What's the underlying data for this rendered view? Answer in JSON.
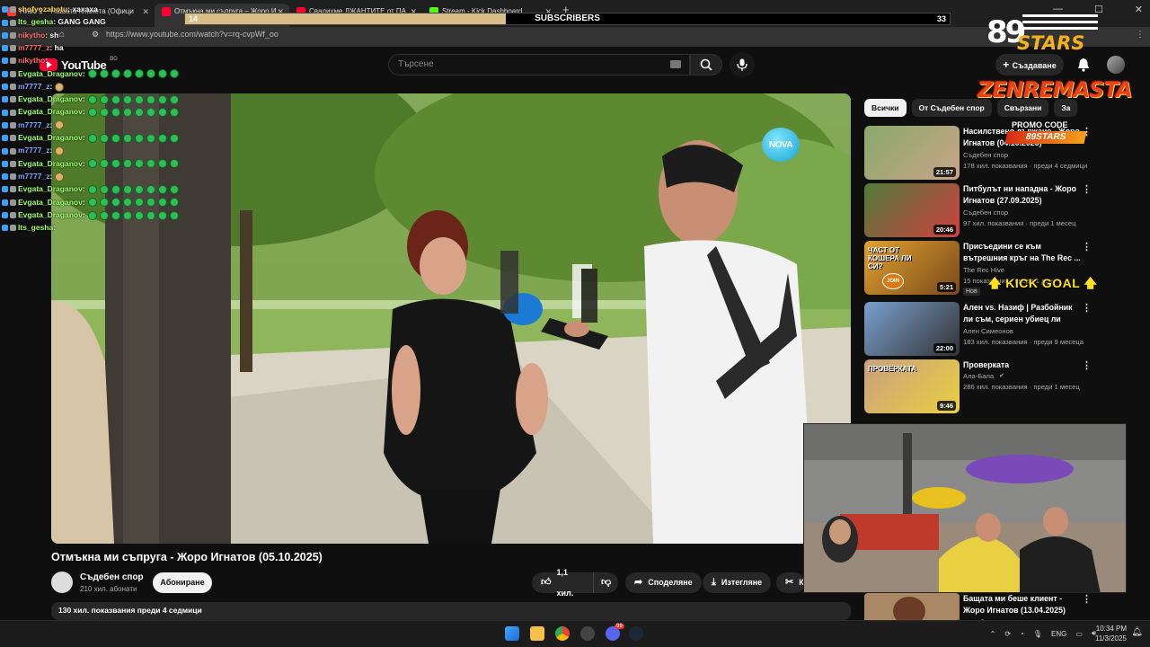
{
  "browser": {
    "tabs": [
      {
        "label": "Ниво 1 – Нашата планета (Офици",
        "fav_color": "#ff3b30"
      },
      {
        "label": "Отмъкна ми съпруга – Жоро И",
        "fav_color": "#ff0033"
      },
      {
        "label": "Свалихме ДЖАНТИТЕ от ПА",
        "fav_color": "#ff0033"
      },
      {
        "label": "Stream - Kick Dashboard",
        "fav_color": "#53fc18"
      }
    ],
    "url": "https://www.youtube.com/watch?v=rq-cvpWf_oo"
  },
  "subs_goal": {
    "current": "14",
    "label": "SUBSCRIBERS",
    "target": "33",
    "progress": 0.42
  },
  "chat": [
    {
      "user": "shofyozabotu",
      "msg": ": хахаха",
      "cls": "u4",
      "emotes": 0
    },
    {
      "user": "Its_gesha",
      "msg": ": GANG GANG",
      "cls": "u2",
      "emotes": 0
    },
    {
      "user": "nikytho",
      "msg": ": sh",
      "cls": "u3",
      "emotes": 0
    },
    {
      "user": "m7777_z",
      "msg": ": ha",
      "cls": "u3",
      "emotes": 0
    },
    {
      "user": "nikytho",
      "msg": ":",
      "cls": "u3",
      "emotes": 0
    },
    {
      "user": "Evgata_Draganov",
      "msg": ":",
      "cls": "u2",
      "emotes": 8
    },
    {
      "user": "m7777_z",
      "msg": ":",
      "cls": "u5",
      "emotes": 1
    },
    {
      "user": "Evgata_Draganov",
      "msg": ":",
      "cls": "u2",
      "emotes": 8
    },
    {
      "user": "Evgata_Draganov",
      "msg": ":",
      "cls": "u2",
      "emotes": 8
    },
    {
      "user": "m7777_z",
      "msg": ":",
      "cls": "u5",
      "emotes": 1
    },
    {
      "user": "Evgata_Draganov",
      "msg": ":",
      "cls": "u2",
      "emotes": 8
    },
    {
      "user": "m7777_z",
      "msg": ":",
      "cls": "u5",
      "emotes": 1
    },
    {
      "user": "Evgata_Draganov",
      "msg": ":",
      "cls": "u2",
      "emotes": 8
    },
    {
      "user": "m7777_z",
      "msg": ":",
      "cls": "u5",
      "emotes": 1
    },
    {
      "user": "Evgata_Draganov",
      "msg": ":",
      "cls": "u2",
      "emotes": 8
    },
    {
      "user": "Evgata_Draganov",
      "msg": ":",
      "cls": "u2",
      "emotes": 8
    },
    {
      "user": "Evgata_Draganov",
      "msg": ":",
      "cls": "u2",
      "emotes": 8
    },
    {
      "user": "Its_gesha",
      "msg": ":",
      "cls": "u2",
      "emotes": 0
    }
  ],
  "youtube": {
    "logo": "YouTube",
    "region": "BG",
    "search_placeholder": "Търсене",
    "create_label": "Създаване"
  },
  "video": {
    "title": "Отмъкна ми съпруга - Жоро Игнатов (05.10.2025)",
    "channel": "Съдебен спор",
    "channel_subs": "210 хил. абонати",
    "subscribe": "Абониране",
    "likes": "1,1 хил.",
    "share": "Споделяне",
    "download": "Изтегляне",
    "clip": "К",
    "views_line": "130 хил. показвания  преди 4 седмици",
    "logo_text": "NOVA"
  },
  "chips": [
    "Всички",
    "От Съдебен спор",
    "Свързани",
    "За"
  ],
  "recommendations": [
    {
      "title": "Насилствено държане - Жоро Игнатов (04.10.2025)",
      "channel": "Съдебен спор",
      "meta": "178 хил. показвания · преди 4 седмици",
      "dur": "21:57",
      "c1": "#8aa86a",
      "c2": "#c9a48a"
    },
    {
      "title": "Питбулът ни нападна - Жоро Игнатов (27.09.2025)",
      "channel": "Съдебен спор",
      "meta": "97 хил. показвания · преди 1 месец",
      "dur": "20:46",
      "c1": "#4f7a3a",
      "c2": "#d04040"
    },
    {
      "title": "Присъедини се към вътрешния кръг на The Rec ...",
      "channel": "The Rec Hive",
      "meta": "15 показвания · преди 1 ден",
      "dur": "5:21",
      "badge": "Нов",
      "c1": "#e0a030",
      "c2": "#7a4a1a",
      "thumb_text": "ЧАСТ ОТ КОШЕРА ЛИ СИ?",
      "thumb_join": "JOIN"
    },
    {
      "title": "Ален vs. Назиф | Разбойник ли съм, сериен убиец ли съм? | ...",
      "channel": "Ален Симеонов",
      "meta": "183 хил. показвания · преди 9 месеца",
      "dur": "22:00",
      "c1": "#7aa0d0",
      "c2": "#333"
    },
    {
      "title": "Проверката",
      "channel": "Ала-Бала",
      "meta": "286 хил. показвания · преди 1 месец",
      "dur": "9:46",
      "c1": "#c9a080",
      "c2": "#e8d040",
      "thumb_text": "ПРОВЕРКАТА",
      "verified": true
    },
    {
      "title": "Бащата ми беше клиент - Жоро Игнатов (13.04.2025)",
      "channel": "Съдебен спор",
      "meta": "",
      "dur": "",
      "c1": "#aa8866",
      "c2": "#666"
    }
  ],
  "overlays": {
    "logo_num": "89",
    "logo_word": "STARS",
    "sponsor": "ZENREMASTA",
    "promo_label": "PROMO CODE",
    "promo_code": "89STARS",
    "kick_goal": "KICK GOAL"
  },
  "taskbar": {
    "lang": "ENG",
    "time": "10:34 PM",
    "date": "11/3/2025",
    "discord_badge": "99"
  }
}
